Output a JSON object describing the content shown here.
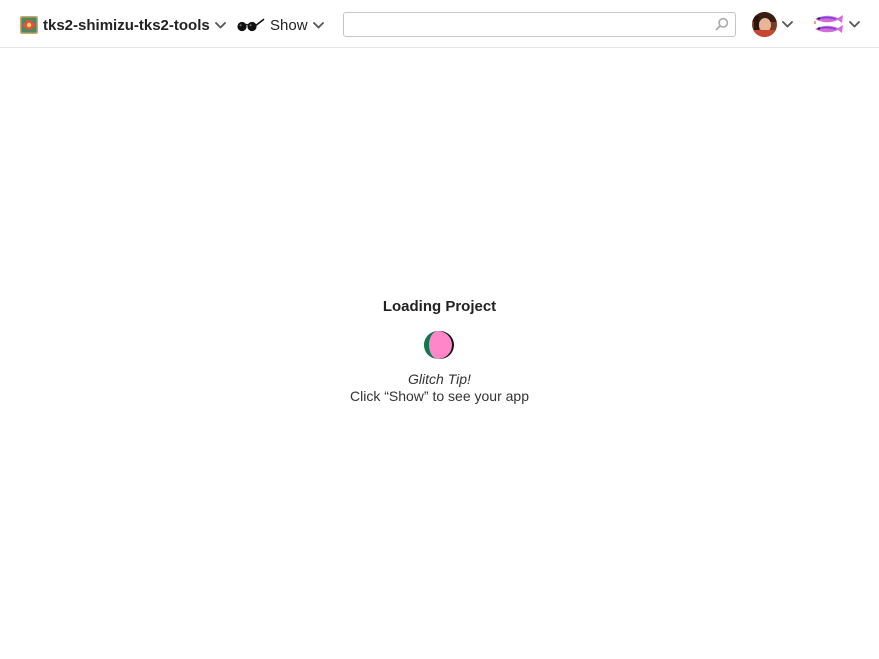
{
  "header": {
    "project": {
      "name": "tks2-shimizu-tks2-tools",
      "avatar_icon": "project-avatar-icon"
    },
    "show": {
      "label": "Show",
      "icon": "glasses-icon"
    },
    "search": {
      "value": "",
      "placeholder": "",
      "icon": "search-icon"
    },
    "user": {
      "avatar_icon": "user-avatar-icon"
    },
    "team": {
      "avatar_icon": "team-avatar-icon"
    }
  },
  "main": {
    "loading_title": "Loading Project",
    "tip_heading": "Glitch Tip!",
    "tip_text": "Click “Show” to see your app"
  },
  "colors": {
    "loader_green": "#0b7a4b",
    "loader_pink": "#ff86c8",
    "border": "#e4e4e4"
  }
}
